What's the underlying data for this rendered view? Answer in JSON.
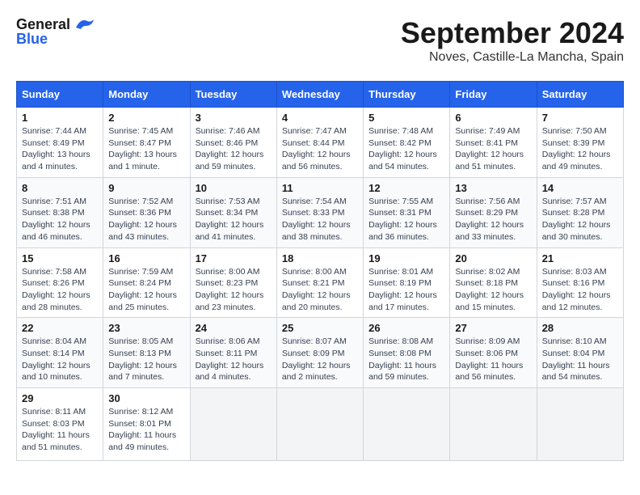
{
  "logo": {
    "line1": "General",
    "line2": "Blue"
  },
  "title": "September 2024",
  "location": "Noves, Castille-La Mancha, Spain",
  "headers": [
    "Sunday",
    "Monday",
    "Tuesday",
    "Wednesday",
    "Thursday",
    "Friday",
    "Saturday"
  ],
  "weeks": [
    [
      {
        "day": "1",
        "info": "Sunrise: 7:44 AM\nSunset: 8:49 PM\nDaylight: 13 hours\nand 4 minutes."
      },
      {
        "day": "2",
        "info": "Sunrise: 7:45 AM\nSunset: 8:47 PM\nDaylight: 13 hours\nand 1 minute."
      },
      {
        "day": "3",
        "info": "Sunrise: 7:46 AM\nSunset: 8:46 PM\nDaylight: 12 hours\nand 59 minutes."
      },
      {
        "day": "4",
        "info": "Sunrise: 7:47 AM\nSunset: 8:44 PM\nDaylight: 12 hours\nand 56 minutes."
      },
      {
        "day": "5",
        "info": "Sunrise: 7:48 AM\nSunset: 8:42 PM\nDaylight: 12 hours\nand 54 minutes."
      },
      {
        "day": "6",
        "info": "Sunrise: 7:49 AM\nSunset: 8:41 PM\nDaylight: 12 hours\nand 51 minutes."
      },
      {
        "day": "7",
        "info": "Sunrise: 7:50 AM\nSunset: 8:39 PM\nDaylight: 12 hours\nand 49 minutes."
      }
    ],
    [
      {
        "day": "8",
        "info": "Sunrise: 7:51 AM\nSunset: 8:38 PM\nDaylight: 12 hours\nand 46 minutes."
      },
      {
        "day": "9",
        "info": "Sunrise: 7:52 AM\nSunset: 8:36 PM\nDaylight: 12 hours\nand 43 minutes."
      },
      {
        "day": "10",
        "info": "Sunrise: 7:53 AM\nSunset: 8:34 PM\nDaylight: 12 hours\nand 41 minutes."
      },
      {
        "day": "11",
        "info": "Sunrise: 7:54 AM\nSunset: 8:33 PM\nDaylight: 12 hours\nand 38 minutes."
      },
      {
        "day": "12",
        "info": "Sunrise: 7:55 AM\nSunset: 8:31 PM\nDaylight: 12 hours\nand 36 minutes."
      },
      {
        "day": "13",
        "info": "Sunrise: 7:56 AM\nSunset: 8:29 PM\nDaylight: 12 hours\nand 33 minutes."
      },
      {
        "day": "14",
        "info": "Sunrise: 7:57 AM\nSunset: 8:28 PM\nDaylight: 12 hours\nand 30 minutes."
      }
    ],
    [
      {
        "day": "15",
        "info": "Sunrise: 7:58 AM\nSunset: 8:26 PM\nDaylight: 12 hours\nand 28 minutes."
      },
      {
        "day": "16",
        "info": "Sunrise: 7:59 AM\nSunset: 8:24 PM\nDaylight: 12 hours\nand 25 minutes."
      },
      {
        "day": "17",
        "info": "Sunrise: 8:00 AM\nSunset: 8:23 PM\nDaylight: 12 hours\nand 23 minutes."
      },
      {
        "day": "18",
        "info": "Sunrise: 8:00 AM\nSunset: 8:21 PM\nDaylight: 12 hours\nand 20 minutes."
      },
      {
        "day": "19",
        "info": "Sunrise: 8:01 AM\nSunset: 8:19 PM\nDaylight: 12 hours\nand 17 minutes."
      },
      {
        "day": "20",
        "info": "Sunrise: 8:02 AM\nSunset: 8:18 PM\nDaylight: 12 hours\nand 15 minutes."
      },
      {
        "day": "21",
        "info": "Sunrise: 8:03 AM\nSunset: 8:16 PM\nDaylight: 12 hours\nand 12 minutes."
      }
    ],
    [
      {
        "day": "22",
        "info": "Sunrise: 8:04 AM\nSunset: 8:14 PM\nDaylight: 12 hours\nand 10 minutes."
      },
      {
        "day": "23",
        "info": "Sunrise: 8:05 AM\nSunset: 8:13 PM\nDaylight: 12 hours\nand 7 minutes."
      },
      {
        "day": "24",
        "info": "Sunrise: 8:06 AM\nSunset: 8:11 PM\nDaylight: 12 hours\nand 4 minutes."
      },
      {
        "day": "25",
        "info": "Sunrise: 8:07 AM\nSunset: 8:09 PM\nDaylight: 12 hours\nand 2 minutes."
      },
      {
        "day": "26",
        "info": "Sunrise: 8:08 AM\nSunset: 8:08 PM\nDaylight: 11 hours\nand 59 minutes."
      },
      {
        "day": "27",
        "info": "Sunrise: 8:09 AM\nSunset: 8:06 PM\nDaylight: 11 hours\nand 56 minutes."
      },
      {
        "day": "28",
        "info": "Sunrise: 8:10 AM\nSunset: 8:04 PM\nDaylight: 11 hours\nand 54 minutes."
      }
    ],
    [
      {
        "day": "29",
        "info": "Sunrise: 8:11 AM\nSunset: 8:03 PM\nDaylight: 11 hours\nand 51 minutes."
      },
      {
        "day": "30",
        "info": "Sunrise: 8:12 AM\nSunset: 8:01 PM\nDaylight: 11 hours\nand 49 minutes."
      },
      {
        "day": "",
        "info": ""
      },
      {
        "day": "",
        "info": ""
      },
      {
        "day": "",
        "info": ""
      },
      {
        "day": "",
        "info": ""
      },
      {
        "day": "",
        "info": ""
      }
    ]
  ]
}
